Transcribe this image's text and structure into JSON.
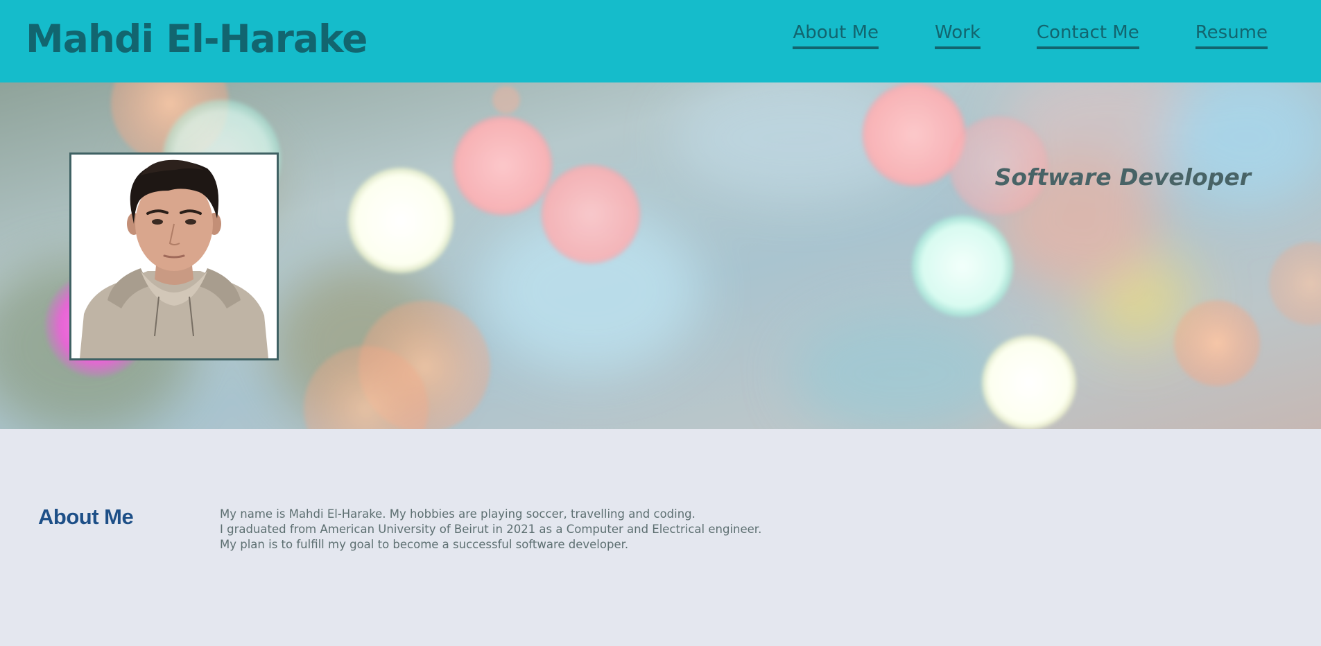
{
  "header": {
    "site_title": "Mahdi El-Harake",
    "nav": {
      "about": "About Me",
      "work": "Work",
      "contact": "Contact Me",
      "resume": "Resume"
    }
  },
  "hero": {
    "tagline": "Software Developer",
    "profile_photo": "profile-photo"
  },
  "about": {
    "heading": "About Me",
    "lines": [
      "My name is Mahdi El-Harake. My hobbies are playing soccer, travelling and coding.",
      "I graduated from American University of Beirut in 2021 as a Computer and Electrical engineer.",
      "My plan is to fulfill my goal to become a successful software developer."
    ]
  },
  "colors": {
    "header_bg": "#15bccb",
    "title_color": "#12656f",
    "heading_blue": "#1d4f87",
    "body_text": "#5d6f71",
    "page_bg": "#e4e7ef"
  }
}
